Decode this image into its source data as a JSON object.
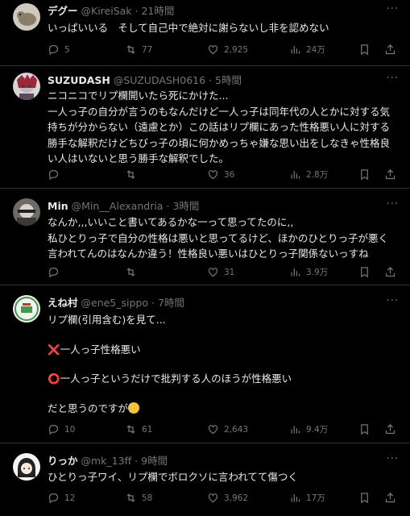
{
  "icons": [
    "reply-icon",
    "retweet-icon",
    "like-icon",
    "views-icon",
    "bookmark-icon",
    "share-icon",
    "more-icon"
  ],
  "tweets": [
    {
      "name": "デグー",
      "handle": "@KireiSak",
      "dot": "·",
      "time": "21時間",
      "more": "···",
      "lines": [
        "いっぱいいる　そして自己中で絶対に謝らないし非を認めない"
      ],
      "replies": "5",
      "retweets": "77",
      "likes": "2,925",
      "views": "24万"
    },
    {
      "name": "SUZUDASH",
      "handle": "@SUZUDASH0616",
      "dot": "·",
      "time": "5時間",
      "more": "···",
      "lines": [
        "ニコニコでリプ欄開いたら死にかけた...",
        "一人っ子の自分が言うのもなんだけど一人っ子は同年代の人とかに対する気",
        "持ちが分からない（遠慮とか）この話はリプ欄にあった性格悪い人に対する",
        "勝手な解釈だけどちびっ子の頃に何かめっちゃ嫌な思い出をしなきゃ性格良",
        "い人はいないと思う勝手な解釈でした。"
      ],
      "replies": "",
      "retweets": "",
      "likes": "36",
      "views": "2.8万"
    },
    {
      "name": "Min",
      "handle": "@Min__Alexandria",
      "dot": "·",
      "time": "3時間",
      "more": "···",
      "lines": [
        "なんか,,,いいこと書いてあるかな一って思ってたのに,,",
        "私ひとりっ子で自分の性格は悪いと思ってるけど、ほかのひとりっ子が悪く",
        "言われてんのはなんか違う！性格良い悪いはひとりっ子関係ないっすね"
      ],
      "replies": "",
      "retweets": "",
      "likes": "31",
      "views": "3.9万"
    },
    {
      "name": "えね村",
      "handle": "@ene5_sippo",
      "dot": "·",
      "time": "7時間",
      "more": "···",
      "line1": "リプ欄(引用含む)を見て...",
      "line2": "一人っ子性格悪い",
      "line3": "一人っ子というだけで批判する人のほうが性格悪い",
      "line4": "だと思うのですが",
      "emoji_x": "❌",
      "emoji_o": "⭕",
      "replies": "10",
      "retweets": "61",
      "likes": "2,643",
      "views": "9.4万"
    },
    {
      "name": "りっか",
      "handle": "@mk_13ff",
      "dot": "·",
      "time": "9時間",
      "more": "···",
      "lines": [
        "ひとりっ子ワイ、リプ欄でボロクソに言われてて傷つく"
      ],
      "replies": "12",
      "retweets": "58",
      "likes": "3,962",
      "views": "17万"
    }
  ]
}
